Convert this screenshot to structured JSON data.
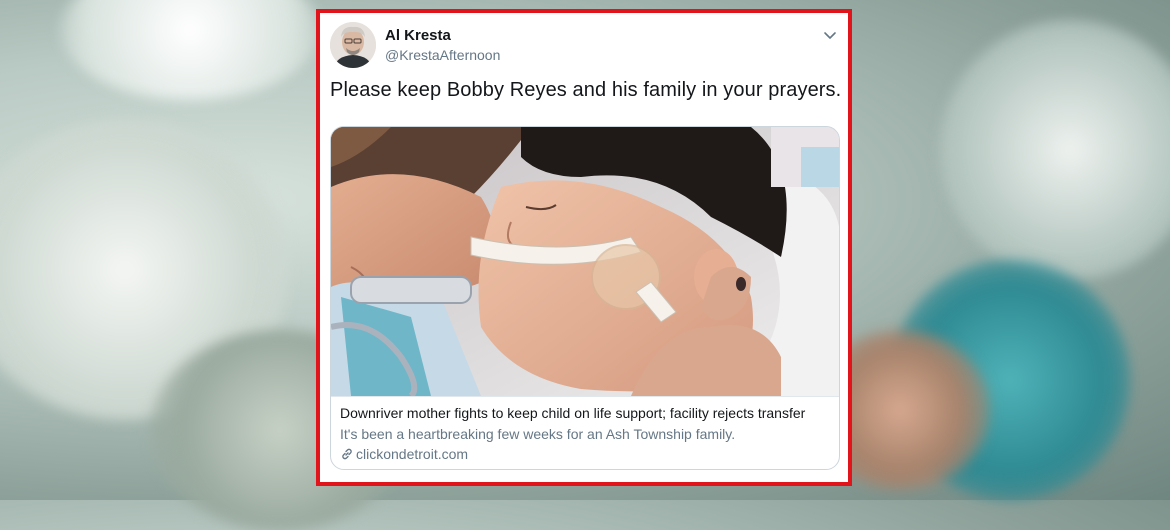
{
  "tweet": {
    "author_name": "Al Kresta",
    "author_handle": "@KrestaAfternoon",
    "text": "Please keep Bobby Reyes and his family in your prayers.",
    "menu_icon": "chevron-down-icon",
    "card": {
      "title": "Downriver mother fights to keep child on life support; facility rejects transfer",
      "description": "It's been a heartbreaking few weeks for an Ash Township family.",
      "domain": "clickondetroit.com",
      "link_icon": "link-icon"
    }
  },
  "colors": {
    "frame_border": "#e1141c",
    "text_primary": "#14171a",
    "text_secondary": "#657786",
    "card_border": "#ccd6dd"
  }
}
